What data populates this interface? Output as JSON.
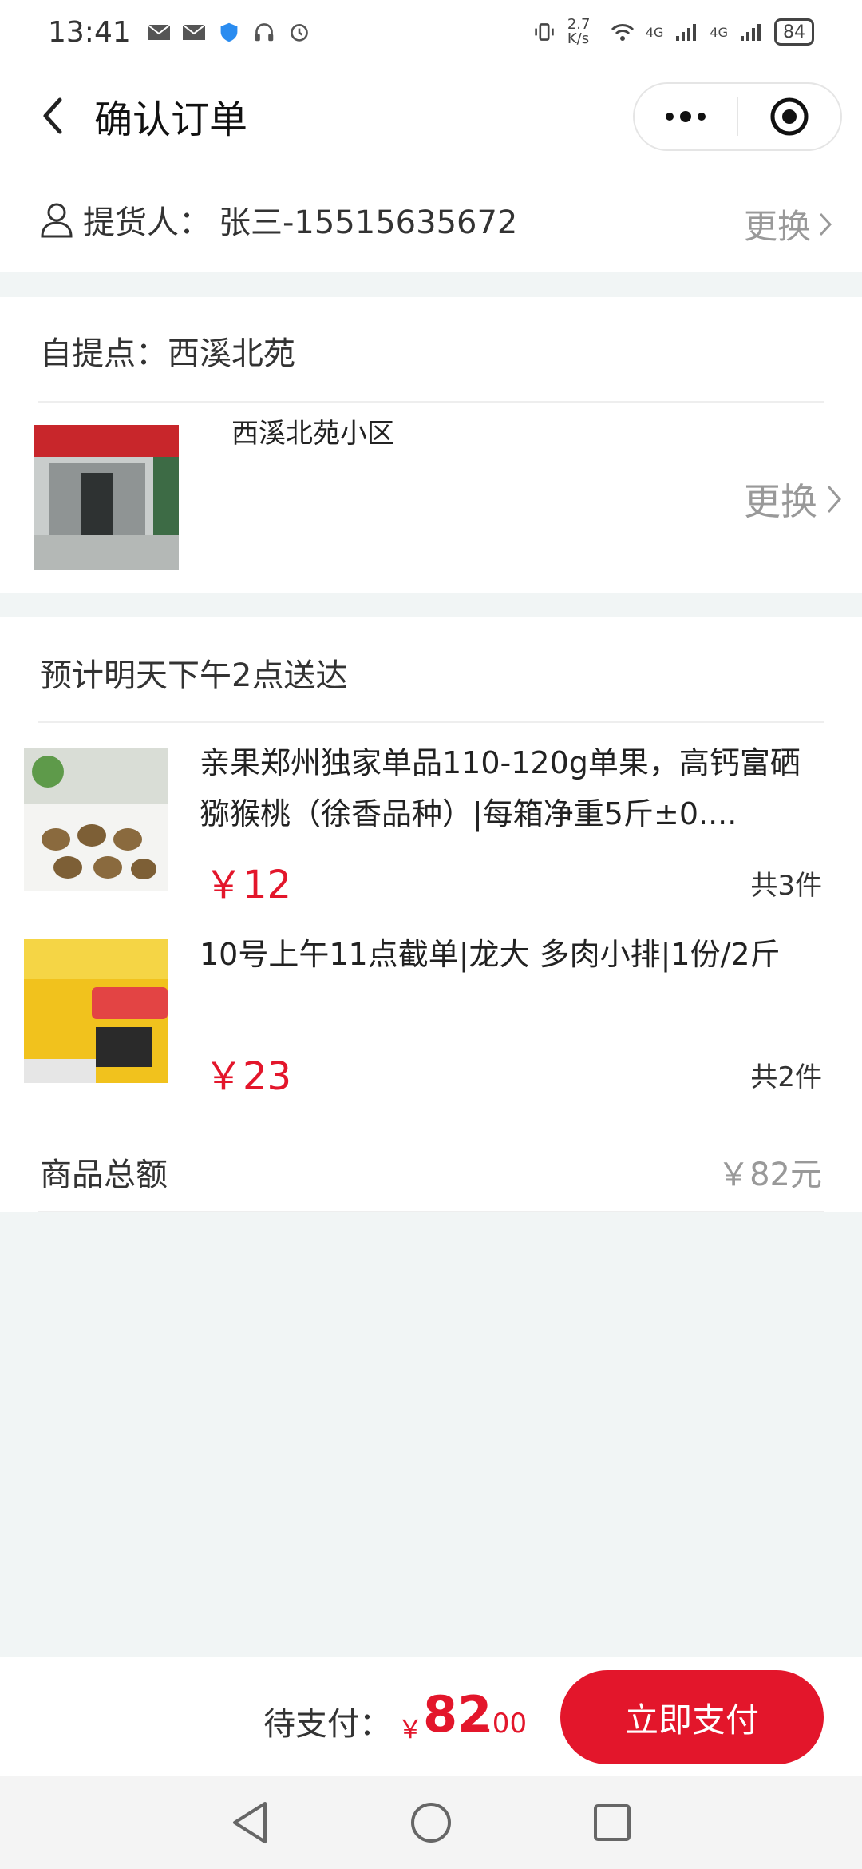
{
  "status_bar": {
    "time": "13:41",
    "net_speed": "2.7 K/s",
    "signal_1": "4G",
    "signal_2": "4G",
    "battery": "84"
  },
  "nav": {
    "title": "确认订单",
    "back_icon": "chevron-left-icon",
    "more_icon": "more-dots-icon",
    "close_icon": "target-circle-icon"
  },
  "picker": {
    "label": "提货人：",
    "value": "张三-15515635672",
    "change_label": "更换"
  },
  "pickup_point": {
    "label": "自提点：西溪北苑",
    "name": "西溪北苑小区",
    "change_label": "更换"
  },
  "order": {
    "delivery_note": "预计明天下午2点送达",
    "products": [
      {
        "name": "亲果郑州独家单品110-120g单果，高钙富硒猕猴桃（徐香品种）|每箱净重5斤±0....",
        "price": "￥12",
        "quantity": "共3件"
      },
      {
        "name": "10号上午11点截单|龙大 多肉小排|1份/2斤",
        "price": "￥23",
        "quantity": "共2件"
      }
    ],
    "total_label": "商品总额",
    "total_value": "￥82元"
  },
  "payment": {
    "label": "待支付：",
    "currency": "￥",
    "amount_int": "82",
    "amount_dec": ".00",
    "pay_button": "立即支付"
  },
  "colors": {
    "accent": "#e3162b",
    "muted": "#999999",
    "background": "#f1f5f5"
  }
}
